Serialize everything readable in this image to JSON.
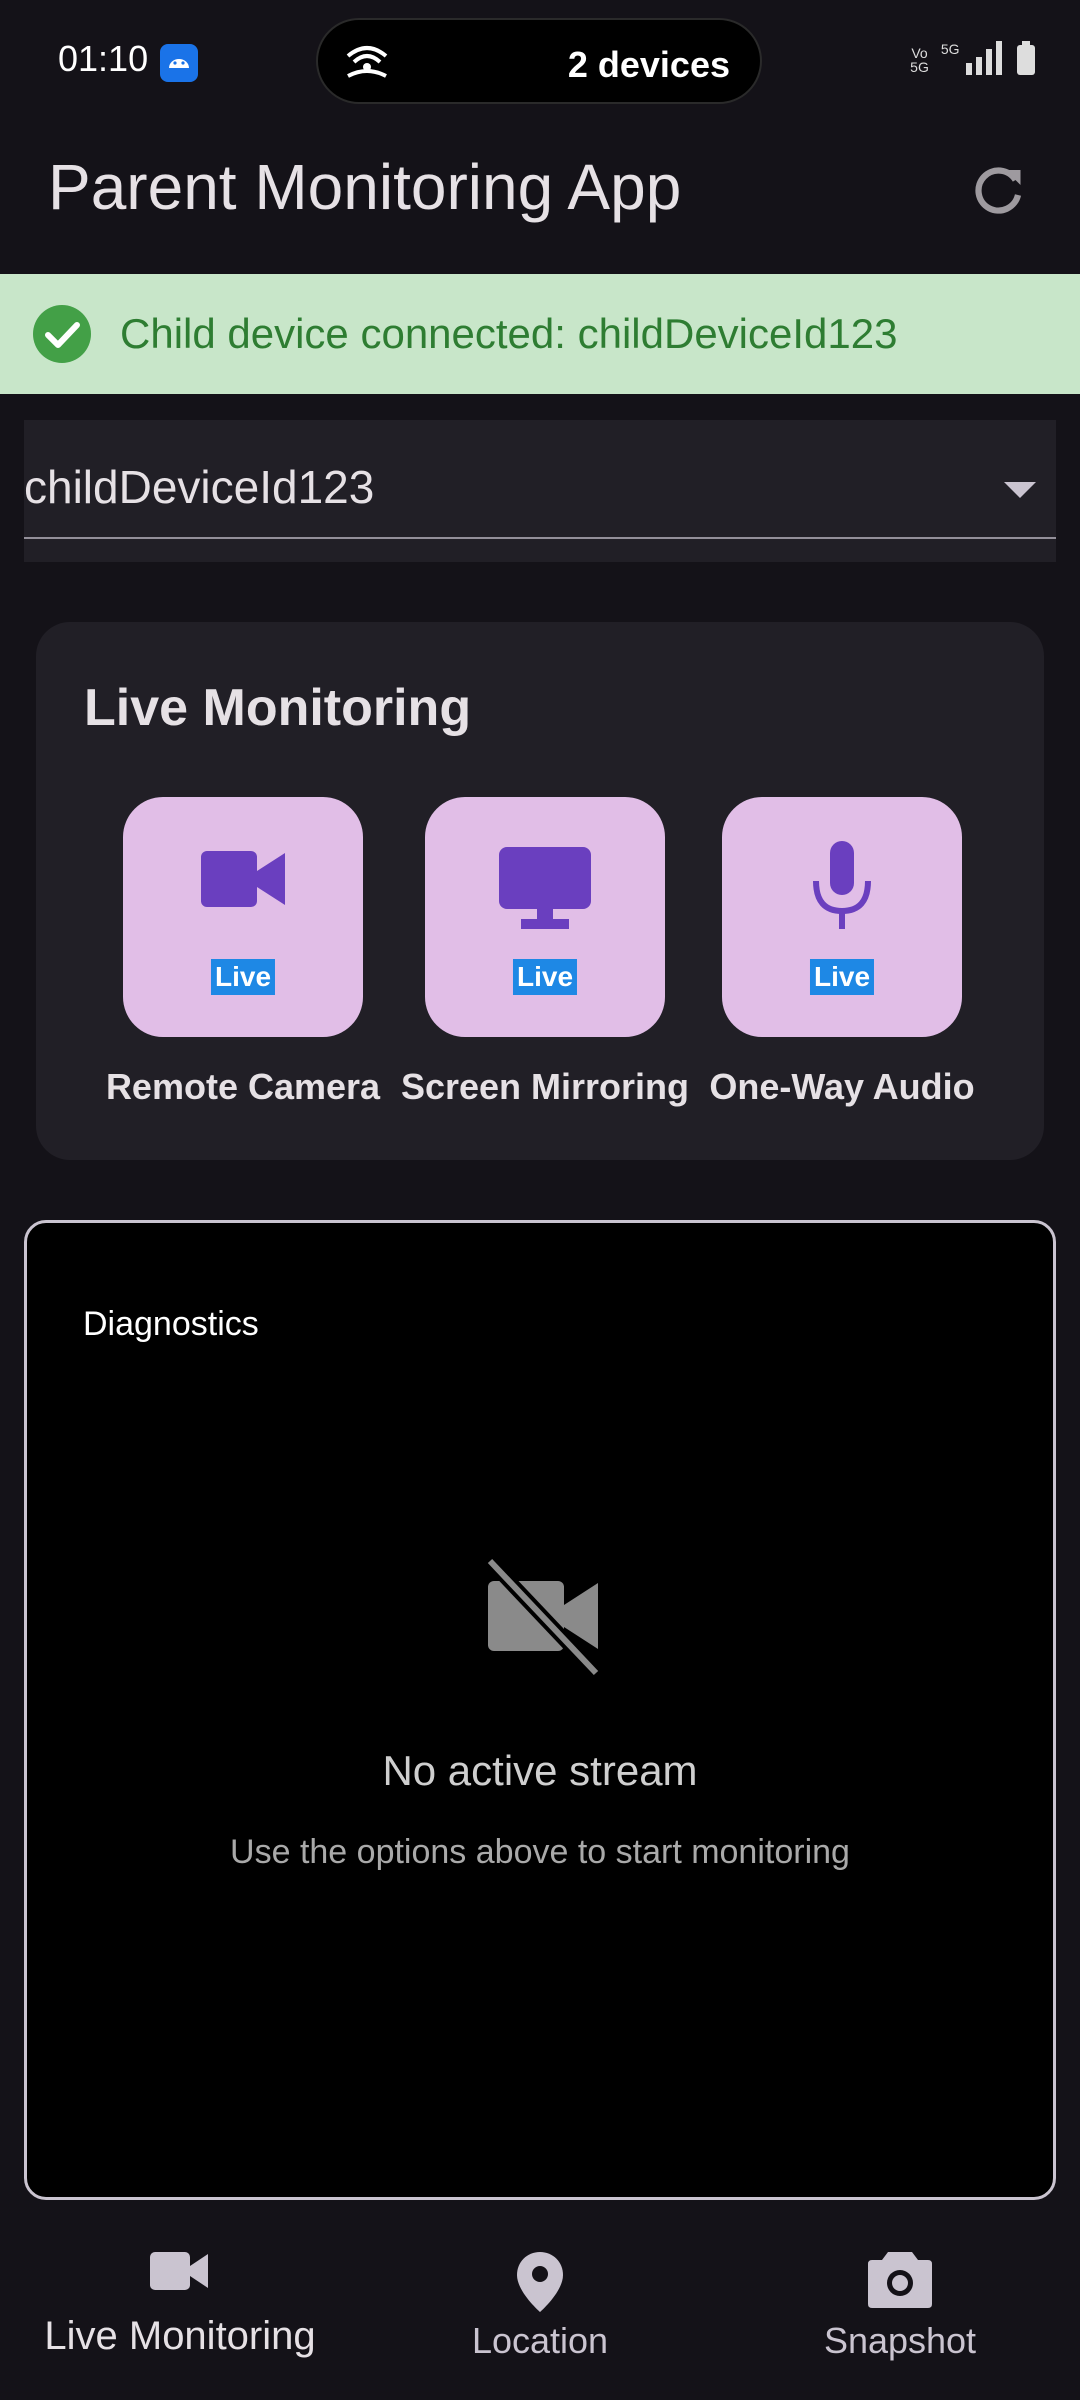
{
  "status_bar": {
    "time": "01:10",
    "pill_text": "2 devices",
    "network": "5G"
  },
  "app_bar": {
    "title": "Parent Monitoring App",
    "refresh_icon": "refresh-icon"
  },
  "banner": {
    "text": "Child device connected: childDeviceId123",
    "icon": "check-circle-icon",
    "color": "#2e7d32",
    "background": "#c8e6c9"
  },
  "device_select": {
    "value": "childDeviceId123"
  },
  "live_monitoring": {
    "title": "Live Monitoring",
    "tiles": [
      {
        "label": "Remote Camera",
        "badge": "Live",
        "icon": "videocam-icon"
      },
      {
        "label": "Screen Mirroring",
        "badge": "Live",
        "icon": "monitor-icon"
      },
      {
        "label": "One-Way Audio",
        "badge": "Live",
        "icon": "mic-icon"
      }
    ]
  },
  "video_panel": {
    "diagnostics": "Diagnostics",
    "empty_title": "No active stream",
    "empty_hint": "Use the options above to start monitoring",
    "icon": "videocam-off-icon"
  },
  "bottom_nav": {
    "items": [
      {
        "label": "Live Monitoring",
        "icon": "videocam-icon"
      },
      {
        "label": "Location",
        "icon": "location-pin-icon"
      },
      {
        "label": "Snapshot",
        "icon": "camera-icon"
      }
    ]
  },
  "colors": {
    "background": "#141218",
    "card": "#211f26",
    "tile": "#e1bee7",
    "tile_icon": "#6a3fbf",
    "live_badge": "#1e88e5"
  }
}
